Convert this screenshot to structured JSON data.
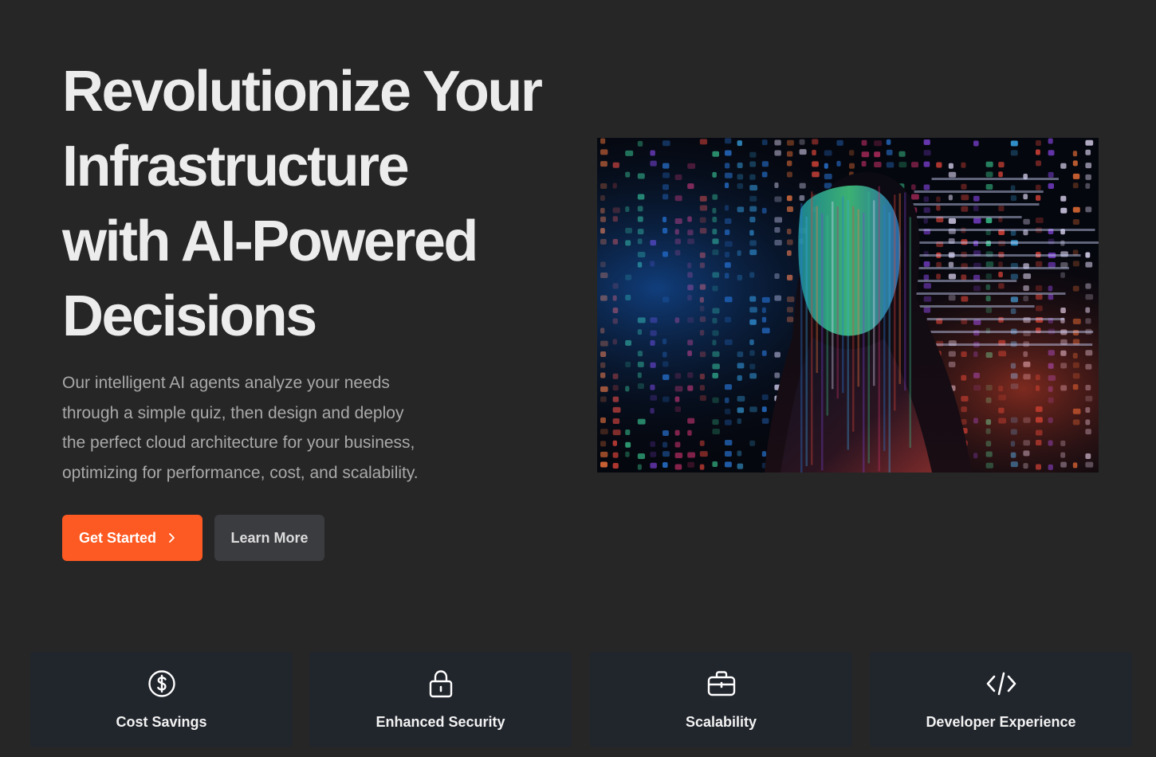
{
  "hero": {
    "title_lines": [
      "Revolutionize Your",
      "Infrastructure",
      "with AI-Powered",
      "Decisions"
    ],
    "description_lines": [
      "Our intelligent AI agents analyze your needs",
      "through a simple quiz, then design and deploy",
      "the perfect cloud architecture for your business,",
      "optimizing for performance, cost, and scalability."
    ],
    "primary_button": "Get Started",
    "secondary_button": "Learn More",
    "image_icon": "woman-with-projected-code-photo"
  },
  "features": [
    {
      "label": "Cost Savings",
      "icon": "dollar-circle-icon"
    },
    {
      "label": "Enhanced Security",
      "icon": "lock-icon"
    },
    {
      "label": "Scalability",
      "icon": "briefcase-icon"
    },
    {
      "label": "Developer Experience",
      "icon": "code-icon"
    }
  ],
  "colors": {
    "background": "#262626",
    "accent": "#fc5a22",
    "secondary_button": "#3b3c40",
    "card": "#21252c"
  }
}
